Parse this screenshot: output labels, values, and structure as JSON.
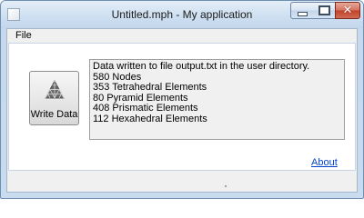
{
  "window": {
    "title": "Untitled.mph - My application"
  },
  "menu": {
    "file": "File"
  },
  "button": {
    "label": "Write Data"
  },
  "output": {
    "lines": [
      "Data written to file output.txt in the user directory.",
      "580 Nodes",
      "353 Tetrahedral Elements",
      "80 Pyramid Elements",
      "408 Prismatic Elements",
      "112 Hexahedral Elements"
    ]
  },
  "links": {
    "about": "About"
  }
}
